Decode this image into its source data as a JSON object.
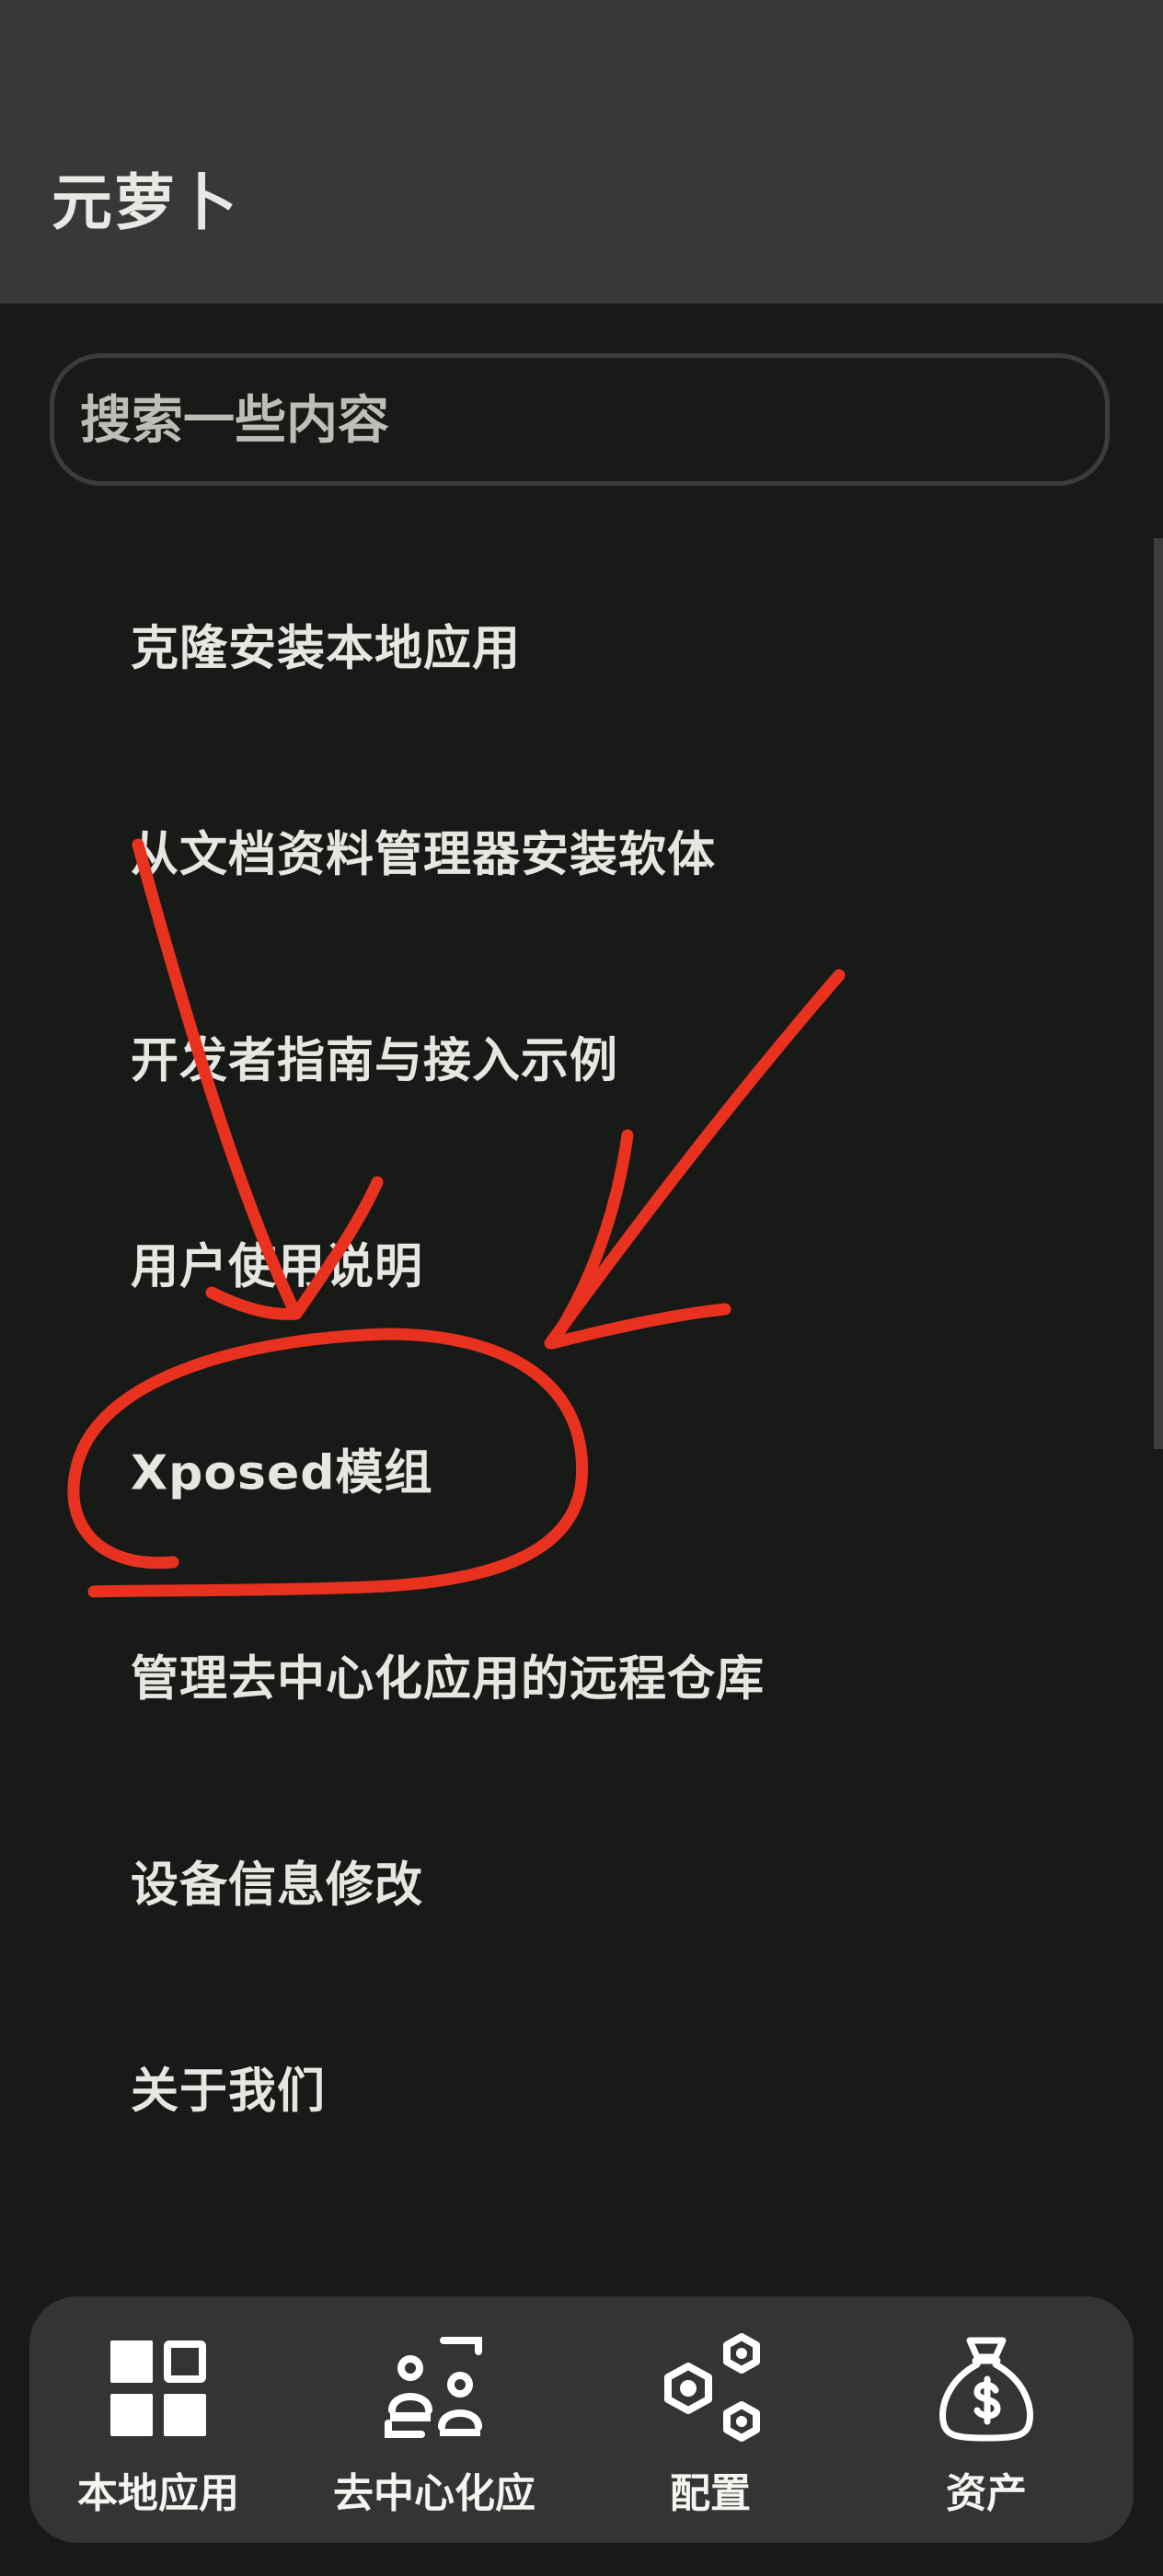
{
  "header": {
    "title": "元萝卜"
  },
  "search": {
    "placeholder": "搜索一些内容"
  },
  "menu": {
    "items": [
      {
        "label": "克隆安装本地应用"
      },
      {
        "label": "从文档资料管理器安装软体"
      },
      {
        "label": "开发者指南与接入示例"
      },
      {
        "label": "用户使用说明"
      },
      {
        "label": "Xposed模组"
      },
      {
        "label": "管理去中心化应用的远程仓库"
      },
      {
        "label": "设备信息修改"
      },
      {
        "label": "关于我们"
      }
    ]
  },
  "bottom_nav": {
    "items": [
      {
        "label": "本地应用",
        "icon": "grid-icon"
      },
      {
        "label": "去中心化应",
        "icon": "scan-users-icon"
      },
      {
        "label": "配置",
        "icon": "hex-nuts-icon"
      },
      {
        "label": "资产",
        "icon": "money-bag-icon"
      }
    ]
  },
  "colors": {
    "background": "#181a18",
    "header": "#383838",
    "nav_background": "#333433",
    "text": "#e6e6e2",
    "annotation": "#e8321f"
  }
}
